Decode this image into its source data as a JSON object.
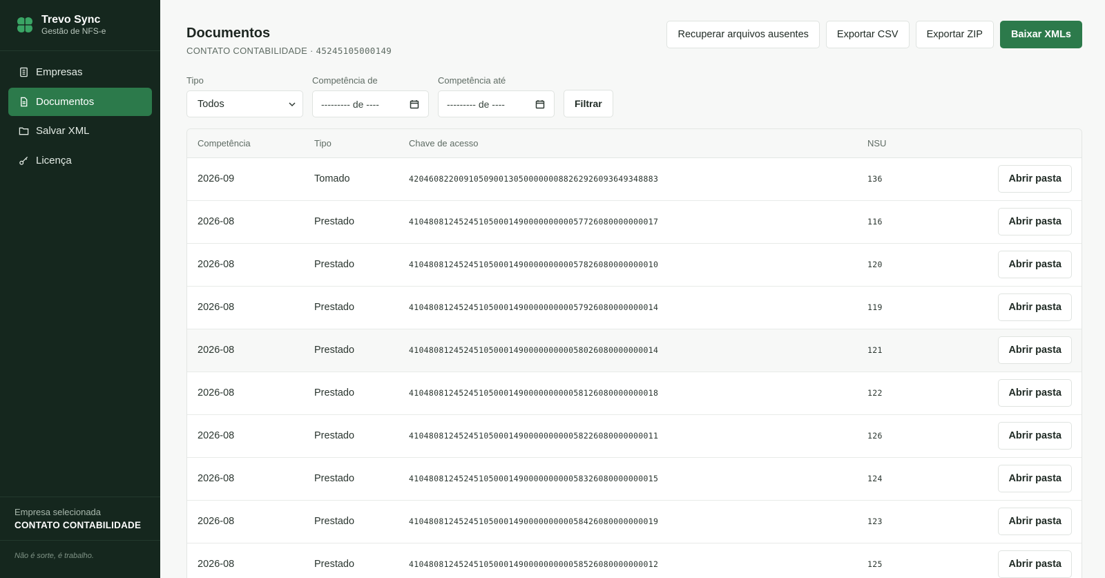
{
  "brand": {
    "name": "Trevo Sync",
    "subtitle": "Gestão de NFS-e",
    "logo_icon": "clover-icon",
    "accent_color": "#2c7a4b",
    "sidebar_color": "#15271e"
  },
  "nav": {
    "items": [
      {
        "label": "Empresas",
        "icon": "building-icon"
      },
      {
        "label": "Documentos",
        "icon": "document-icon",
        "active": true
      },
      {
        "label": "Salvar XML",
        "icon": "folder-icon"
      },
      {
        "label": "Licença",
        "icon": "key-icon"
      }
    ]
  },
  "footer": {
    "selected_label": "Empresa selecionada",
    "selected_value": "CONTATO CONTABILIDADE",
    "motto": "Não é sorte, é trabalho."
  },
  "header": {
    "title": "Documentos",
    "company": "CONTATO CONTABILIDADE",
    "separator": " · ",
    "cnpj": "45245105000149"
  },
  "actions": {
    "recover": "Recuperar arquivos ausentes",
    "export_csv": "Exportar CSV",
    "export_zip": "Exportar ZIP",
    "download_xml": "Baixar XMLs"
  },
  "filters": {
    "tipo_label": "Tipo",
    "tipo_value": "Todos",
    "comp_from_label": "Competência de",
    "comp_from_value": "--------- de ----",
    "comp_to_label": "Competência até",
    "comp_to_value": "--------- de ----",
    "filter_button": "Filtrar"
  },
  "table": {
    "headers": {
      "competencia": "Competência",
      "tipo": "Tipo",
      "chave": "Chave de acesso",
      "nsu": "NSU"
    },
    "row_button": "Abrir pasta",
    "rows": [
      {
        "competencia": "2026-09",
        "tipo": "Tomado",
        "chave": "42046082200910509001305000000088262926093649348883",
        "nsu": "136"
      },
      {
        "competencia": "2026-08",
        "tipo": "Prestado",
        "chave": "41048081245245105000149000000000057726080000000017",
        "nsu": "116"
      },
      {
        "competencia": "2026-08",
        "tipo": "Prestado",
        "chave": "41048081245245105000149000000000057826080000000010",
        "nsu": "120"
      },
      {
        "competencia": "2026-08",
        "tipo": "Prestado",
        "chave": "41048081245245105000149000000000057926080000000014",
        "nsu": "119"
      },
      {
        "competencia": "2026-08",
        "tipo": "Prestado",
        "chave": "41048081245245105000149000000000058026080000000014",
        "nsu": "121"
      },
      {
        "competencia": "2026-08",
        "tipo": "Prestado",
        "chave": "41048081245245105000149000000000058126080000000018",
        "nsu": "122"
      },
      {
        "competencia": "2026-08",
        "tipo": "Prestado",
        "chave": "41048081245245105000149000000000058226080000000011",
        "nsu": "126"
      },
      {
        "competencia": "2026-08",
        "tipo": "Prestado",
        "chave": "41048081245245105000149000000000058326080000000015",
        "nsu": "124"
      },
      {
        "competencia": "2026-08",
        "tipo": "Prestado",
        "chave": "41048081245245105000149000000000058426080000000019",
        "nsu": "123"
      },
      {
        "competencia": "2026-08",
        "tipo": "Prestado",
        "chave": "41048081245245105000149000000000058526080000000012",
        "nsu": "125"
      }
    ]
  }
}
